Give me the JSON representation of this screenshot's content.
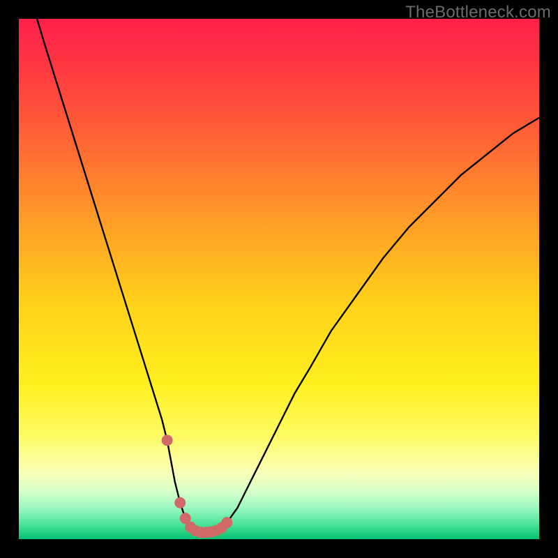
{
  "watermark": "TheBottleneck.com",
  "colors": {
    "background": "#000000",
    "curve_stroke": "#000000",
    "marker_fill": "#d06a68",
    "gradient_stops": [
      {
        "offset": 0.0,
        "color": "#ff1f4b"
      },
      {
        "offset": 0.1,
        "color": "#ff3a41"
      },
      {
        "offset": 0.25,
        "color": "#ff6a33"
      },
      {
        "offset": 0.4,
        "color": "#ffa126"
      },
      {
        "offset": 0.55,
        "color": "#ffd21a"
      },
      {
        "offset": 0.7,
        "color": "#ffef1e"
      },
      {
        "offset": 0.8,
        "color": "#fdfb62"
      },
      {
        "offset": 0.87,
        "color": "#f9ffb5"
      },
      {
        "offset": 0.91,
        "color": "#d4ffc9"
      },
      {
        "offset": 0.94,
        "color": "#9bf7c0"
      },
      {
        "offset": 0.97,
        "color": "#4ee59a"
      },
      {
        "offset": 1.0,
        "color": "#05c171"
      }
    ]
  },
  "chart_data": {
    "type": "line",
    "title": "",
    "xlabel": "",
    "ylabel": "",
    "xlim": [
      0,
      100
    ],
    "ylim": [
      0,
      100
    ],
    "x": [
      3.5,
      5,
      7.5,
      10,
      12.5,
      15,
      17.5,
      20,
      22.5,
      25,
      27.5,
      28.5,
      30,
      31,
      32,
      33,
      34,
      35,
      36,
      37,
      38,
      39,
      40,
      42,
      44,
      46,
      48,
      50,
      53,
      56,
      60,
      65,
      70,
      75,
      80,
      85,
      90,
      95,
      100
    ],
    "values": [
      100,
      95,
      87,
      79,
      71,
      63,
      55,
      47,
      39,
      31,
      23,
      19,
      11,
      7,
      4,
      2.3,
      1.6,
      1.3,
      1.3,
      1.4,
      1.7,
      2.2,
      3.2,
      6,
      10,
      14,
      18,
      22,
      28,
      33,
      40,
      47,
      54,
      60,
      65,
      70,
      74,
      78,
      81
    ],
    "markers": {
      "x": [
        28.5,
        31,
        32,
        33,
        34,
        35,
        36,
        37,
        38,
        39,
        40
      ],
      "values": [
        19,
        7,
        4,
        2.3,
        1.6,
        1.3,
        1.3,
        1.4,
        1.7,
        2.2,
        3.2
      ]
    }
  }
}
